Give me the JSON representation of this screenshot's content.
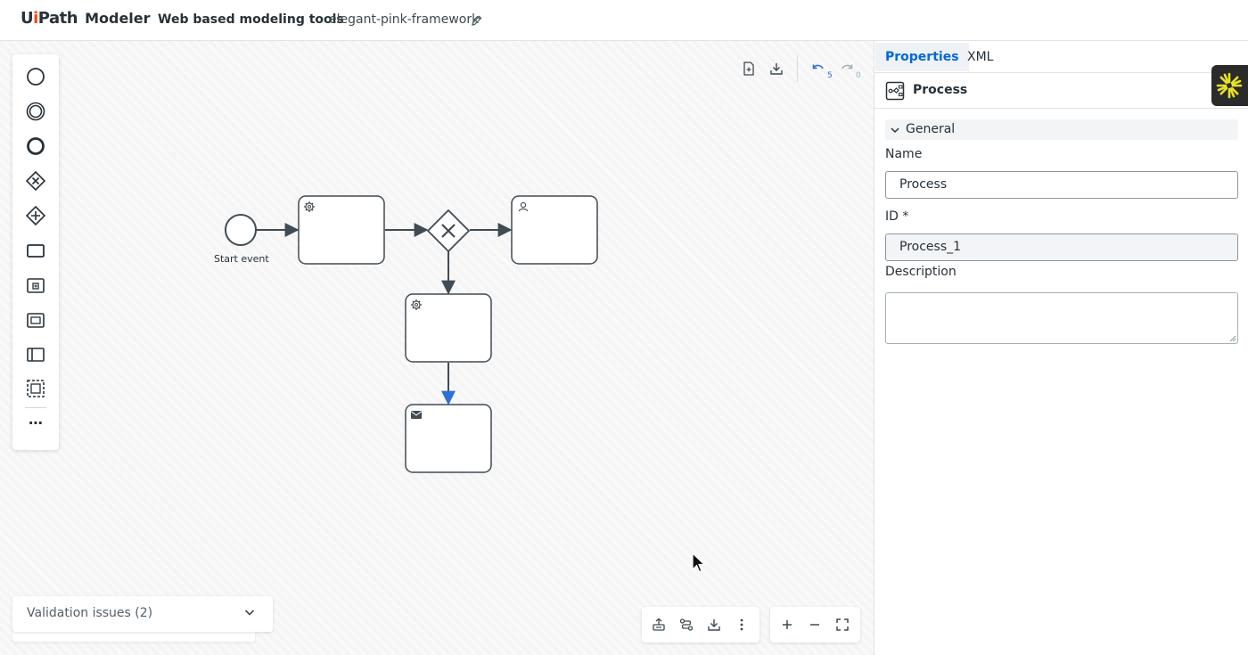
{
  "header": {
    "brand_ui": "Ui",
    "brand_path": "Path",
    "brand_product": "Modeler",
    "app_title": "Web based modeling tools",
    "project_name": "elegant-pink-framework"
  },
  "toolbar": {
    "undo_count": "5",
    "redo_count": "0"
  },
  "diagram": {
    "start_event_label": "Start event"
  },
  "validation": {
    "label": "Validation issues (2)"
  },
  "panel": {
    "tabs": [
      {
        "label": "Properties",
        "active": true
      },
      {
        "label": "XML",
        "active": false
      }
    ],
    "element_title": "Process",
    "section_label": "General",
    "fields": {
      "name_label": "Name",
      "name_value": "Process",
      "id_label": "ID *",
      "id_value": "Process_1",
      "description_label": "Description",
      "description_value": ""
    }
  },
  "colors": {
    "accent": "#0067df",
    "brand_i": "#fa4616",
    "sequence_flow": "#404b53",
    "selected_flow": "#2f6fd6"
  },
  "icons": {
    "palette": [
      "start-event-icon",
      "intermediate-event-icon",
      "end-event-icon",
      "exclusive-gateway-icon",
      "parallel-gateway-icon",
      "task-icon",
      "subprocess-icon",
      "call-activity-icon",
      "pool-icon",
      "group-icon",
      "more-icon"
    ],
    "toolbar": [
      "new-file-icon",
      "download-icon",
      "undo-icon",
      "redo-icon"
    ],
    "bottom": [
      "tidy-icon",
      "connect-icon",
      "export-icon",
      "kebab-icon",
      "zoom-in-icon",
      "zoom-out-icon",
      "fit-icon"
    ]
  }
}
